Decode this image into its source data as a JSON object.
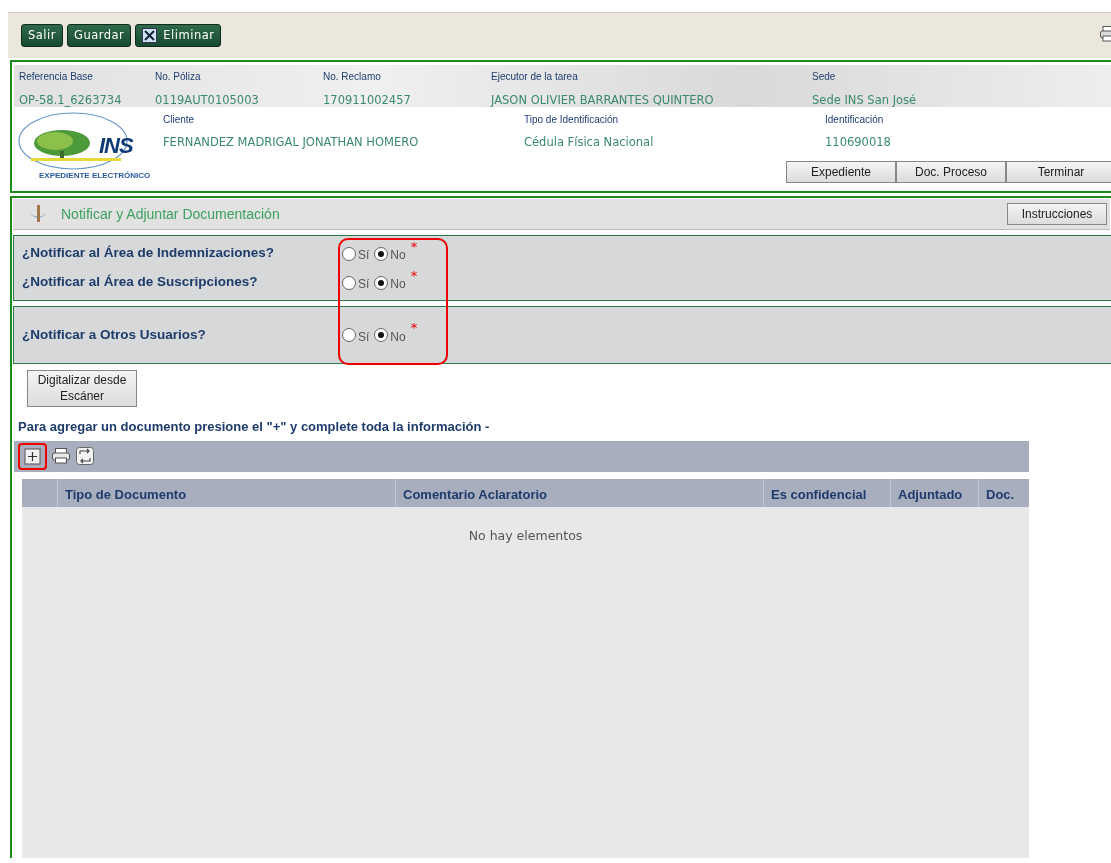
{
  "toolbar": {
    "buttons": [
      {
        "label": "Salir",
        "kind": "plain"
      },
      {
        "label": "Guardar",
        "kind": "plain"
      },
      {
        "label": "Eliminar",
        "kind": "delete"
      }
    ]
  },
  "header": {
    "top_fields": [
      {
        "label": "Referencia Base",
        "value": "OP-58.1_6263734"
      },
      {
        "label": "No. Póliza",
        "value": "0119AUT0105003"
      },
      {
        "label": "No. Reclamo",
        "value": "170911002457"
      },
      {
        "label": "Ejecutor de la tarea",
        "value": "JASON OLIVIER BARRANTES QUINTERO"
      },
      {
        "label": "Sede",
        "value": "Sede INS San José"
      }
    ],
    "logo": {
      "name": "INS",
      "subtitle": "EXPEDIENTE ELECTRÓNICO"
    },
    "client_fields": [
      {
        "label": "Cliente",
        "value": "FERNANDEZ MADRIGAL JONATHAN HOMERO"
      },
      {
        "label": "Tipo de Identificación",
        "value": "Cédula Física Nacional"
      },
      {
        "label": "Identificación",
        "value": "110690018"
      }
    ],
    "buttons": [
      "Expediente",
      "Doc. Proceso",
      "Terminar"
    ]
  },
  "section": {
    "title": "Notificar y Adjuntar Documentación",
    "instructions_button": "Instrucciones",
    "question_groups": [
      [
        {
          "question": "¿Notificar al Área de Indemnizaciones?",
          "required_mark": "*",
          "options": [
            {
              "label": "Sí",
              "selected": false
            },
            {
              "label": "No",
              "selected": true
            }
          ]
        },
        {
          "question": "¿Notificar al Área de Suscripciones?",
          "required_mark": "*",
          "options": [
            {
              "label": "Sí",
              "selected": false
            },
            {
              "label": "No",
              "selected": true
            }
          ]
        }
      ],
      [
        {
          "question": "¿Notificar a Otros Usuarios?",
          "required_mark": "*",
          "options": [
            {
              "label": "Sí",
              "selected": false
            },
            {
              "label": "No",
              "selected": true
            }
          ]
        }
      ]
    ],
    "scan_button": "Digitalizar desde Escáner",
    "hint": "Para agregar un documento presione el \"+\" y complete toda la información -",
    "table": {
      "columns": [
        "Tipo de Documento",
        "Comentario Aclaratorio",
        "Es confidencial",
        "Adjuntado",
        "Doc."
      ],
      "empty_message": "No hay elementos"
    }
  }
}
